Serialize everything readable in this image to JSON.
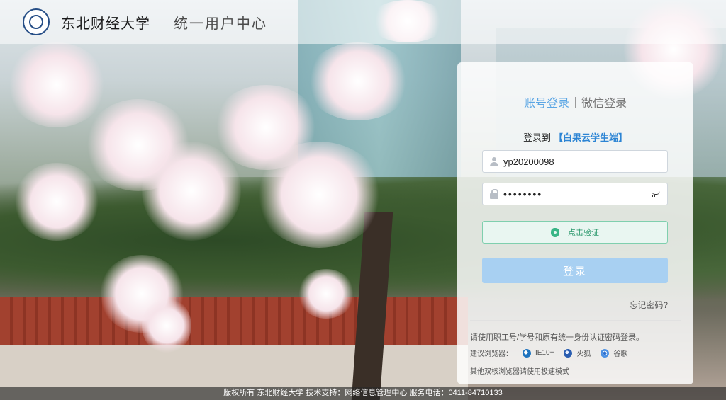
{
  "header": {
    "school_name": "东北财经大学",
    "system_name": "统一用户中心"
  },
  "login": {
    "tabs": [
      "账号登录",
      "微信登录"
    ],
    "login_to_prefix": "登录到",
    "app_name": "【白果云学生端】",
    "username_value": "yp20200098",
    "password_value": "••••••••",
    "verify_label": "点击验证",
    "login_button": "登录",
    "forgot_password": "忘记密码?",
    "note": "请使用职工号/学号和原有统一身份认证密码登录。",
    "browsers_label": "建议浏览器：",
    "browsers": [
      {
        "name": "IE10+",
        "icon": "ie-icon"
      },
      {
        "name": "火狐",
        "icon": "firefox-icon"
      },
      {
        "name": "谷歌",
        "icon": "chrome-icon"
      }
    ],
    "note2": "其他双核浏览器请使用极速模式"
  },
  "footer": {
    "text": "版权所有 东北财经大学 技术支持：网络信息管理中心 服务电话：0411-84710133"
  },
  "colors": {
    "accent": "#5ba6e4",
    "app_name": "#2c84d4",
    "login_button": "#a8d0f2",
    "verify_border": "#7fcfae"
  }
}
